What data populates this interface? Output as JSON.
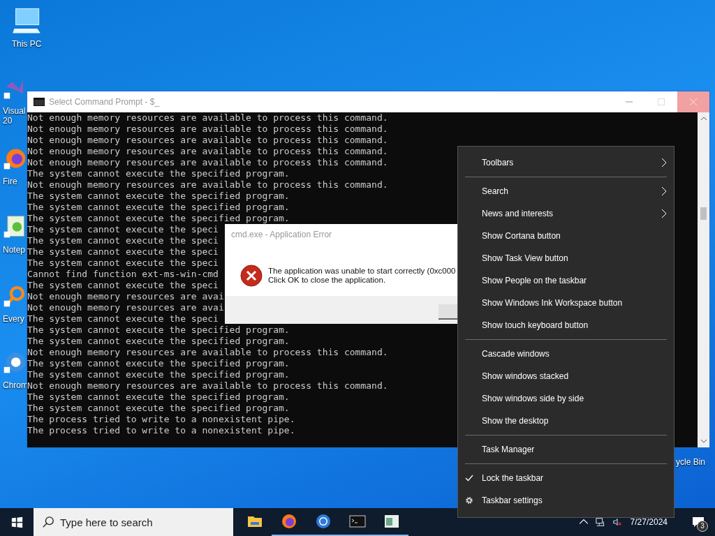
{
  "desktop_icons": [
    {
      "kind": "pc",
      "lines": [
        "This PC"
      ]
    },
    {
      "kind": "vs",
      "lines": [
        "Visual",
        "20"
      ]
    },
    {
      "kind": "firefox",
      "lines": [
        "Fire"
      ]
    },
    {
      "kind": "notepad",
      "lines": [
        "Notep"
      ]
    },
    {
      "kind": "search",
      "lines": [
        "Every"
      ]
    },
    {
      "kind": "chrome",
      "lines": [
        "Chrom"
      ]
    },
    {
      "kind": "bin",
      "lines": [
        "ycle Bin"
      ]
    }
  ],
  "console": {
    "title": "Select Command Prompt - $_",
    "lines": [
      "Not enough memory resources are available to process this command.",
      "Not enough memory resources are available to process this command.",
      "Not enough memory resources are available to process this command.",
      "Not enough memory resources are available to process this command.",
      "Not enough memory resources are available to process this command.",
      "The system cannot execute the specified program.",
      "Not enough memory resources are available to process this command.",
      "The system cannot execute the specified program.",
      "The system cannot execute the specified program.",
      "The system cannot execute the specified program.",
      "The system cannot execute the speci",
      "The system cannot execute the speci",
      "The system cannot execute the speci",
      "The system cannot execute the speci",
      "Cannot find function ext-ms-win-cmd",
      "The system cannot execute the speci",
      "Not enough memory resources are avai",
      "Not enough memory resources are avai",
      "The system cannot execute the speci",
      "The system cannot execute the specified program.",
      "The system cannot execute the specified program.",
      "Not enough memory resources are available to process this command.",
      "The system cannot execute the specified program.",
      "The system cannot execute the specified program.",
      "Not enough memory resources are available to process this command.",
      "The system cannot execute the specified program.",
      "The system cannot execute the specified program.",
      "The process tried to write to a nonexistent pipe.",
      "The process tried to write to a nonexistent pipe."
    ]
  },
  "error_dialog": {
    "title": "cmd.exe - Application Error",
    "message": [
      "The application was unable to start correctly (0xc000",
      "Click OK to close the application."
    ]
  },
  "context_menu": {
    "sections": [
      [
        {
          "label": "Toolbars",
          "kind": "submenu",
          "checked": false
        }
      ],
      [
        {
          "label": "Search",
          "kind": "submenu",
          "checked": false
        },
        {
          "label": "News and interests",
          "kind": "submenu",
          "checked": false
        },
        {
          "label": "Show Cortana button",
          "kind": "plain",
          "checked": false
        },
        {
          "label": "Show Task View button",
          "kind": "plain",
          "checked": false
        },
        {
          "label": "Show People on the taskbar",
          "kind": "plain",
          "checked": false
        },
        {
          "label": "Show Windows Ink Workspace button",
          "kind": "plain",
          "checked": false
        },
        {
          "label": "Show touch keyboard button",
          "kind": "plain",
          "checked": false
        }
      ],
      [
        {
          "label": "Cascade windows",
          "kind": "plain",
          "checked": false
        },
        {
          "label": "Show windows stacked",
          "kind": "plain",
          "checked": false
        },
        {
          "label": "Show windows side by side",
          "kind": "plain",
          "checked": false
        },
        {
          "label": "Show the desktop",
          "kind": "plain",
          "checked": false
        }
      ],
      [
        {
          "label": "Task Manager",
          "kind": "plain",
          "checked": false
        }
      ],
      [
        {
          "label": "Lock the taskbar",
          "kind": "plain",
          "checked": true
        },
        {
          "label": "Taskbar settings",
          "kind": "settings",
          "checked": false
        }
      ]
    ]
  },
  "taskbar": {
    "search": {
      "placeholder": "Type here to search"
    },
    "apps": [
      {
        "kind": "folder",
        "running": false
      },
      {
        "kind": "firefox",
        "running": true
      },
      {
        "kind": "chrome",
        "running": true
      },
      {
        "kind": "console",
        "running": true
      },
      {
        "kind": "notepad",
        "running": true
      }
    ],
    "date": "7/27/2024",
    "notifications": "3"
  }
}
